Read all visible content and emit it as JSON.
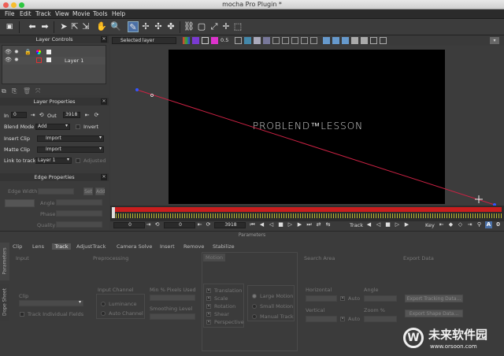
{
  "window": {
    "title": "mocha Pro Plugin *"
  },
  "menu": [
    "File",
    "Edit",
    "Track",
    "View",
    "Movie",
    "Tools",
    "Help"
  ],
  "viewer_toolbar": {
    "layer_select": "Selected layer",
    "overlay_value": "0.5"
  },
  "layer_controls": {
    "title": "Layer Controls",
    "layers": [
      {
        "name": "Layer 1"
      }
    ]
  },
  "layer_properties": {
    "title": "Layer Properties",
    "in_label": "In",
    "in_value": "0",
    "out_label": "Out",
    "out_value": "3918",
    "blend_mode_label": "Blend Mode",
    "blend_mode_value": "Add",
    "invert_label": "Invert",
    "insert_clip_label": "Insert Clip",
    "insert_clip_value": "Import",
    "matte_clip_label": "Matte Clip",
    "matte_clip_value": "Import",
    "link_to_track_label": "Link to track",
    "link_to_track_value": "Layer 1",
    "adjusted_label": "Adjusted"
  },
  "edge_properties": {
    "title": "Edge Properties",
    "edge_width_label": "Edge Width",
    "set_button": "Set",
    "add_button": "Add",
    "angle_label": "Angle",
    "phase_label": "Phase",
    "quality_label": "Quality"
  },
  "viewer": {
    "overlay_text": "PROBLEND™LESSON"
  },
  "timeline": {
    "start_frame": "0",
    "current_frame": "0",
    "end_frame": "3918",
    "track_label": "Track",
    "key_label": "Key"
  },
  "parameters": {
    "title": "Parameters",
    "side_tabs": [
      "Parameters",
      "Dope Sheet"
    ],
    "tabs": [
      "Clip",
      "Lens",
      "Track",
      "AdjustTrack",
      "Camera Solve",
      "Insert",
      "Remove",
      "Stabilize"
    ],
    "active_tab": "Track",
    "input": {
      "title": "Input",
      "clip_label": "Clip",
      "track_individual_fields": "Track Individual Fields"
    },
    "preprocessing": {
      "title": "Preprocessing",
      "input_channel_label": "Input Channel",
      "luminance": "Luminance",
      "auto_channel": "Auto Channel",
      "min_pixels_label": "Min % Pixels Used",
      "smoothing_label": "Smoothing Level"
    },
    "motion": {
      "title": "Motion",
      "translation": "Translation",
      "scale": "Scale",
      "rotation": "Rotation",
      "shear": "Shear",
      "perspective": "Perspective",
      "large_motion": "Large Motion",
      "small_motion": "Small Motion",
      "manual_track": "Manual Track"
    },
    "search_area": {
      "title": "Search Area",
      "horizontal_label": "Horizontal",
      "vertical_label": "Vertical",
      "auto_label": "Auto",
      "angle_label": "Angle",
      "zoom_label": "Zoom %"
    },
    "export_data": {
      "title": "Export Data",
      "export_tracking": "Export Tracking Data...",
      "export_shape": "Export Shape Data..."
    }
  },
  "watermark": {
    "text": "未来软件园",
    "url": "www.orsoon.com"
  },
  "colors": {
    "accent": "#4a6fa5",
    "timeline_red": "#c81e1e",
    "track_line": "#cc2244"
  }
}
